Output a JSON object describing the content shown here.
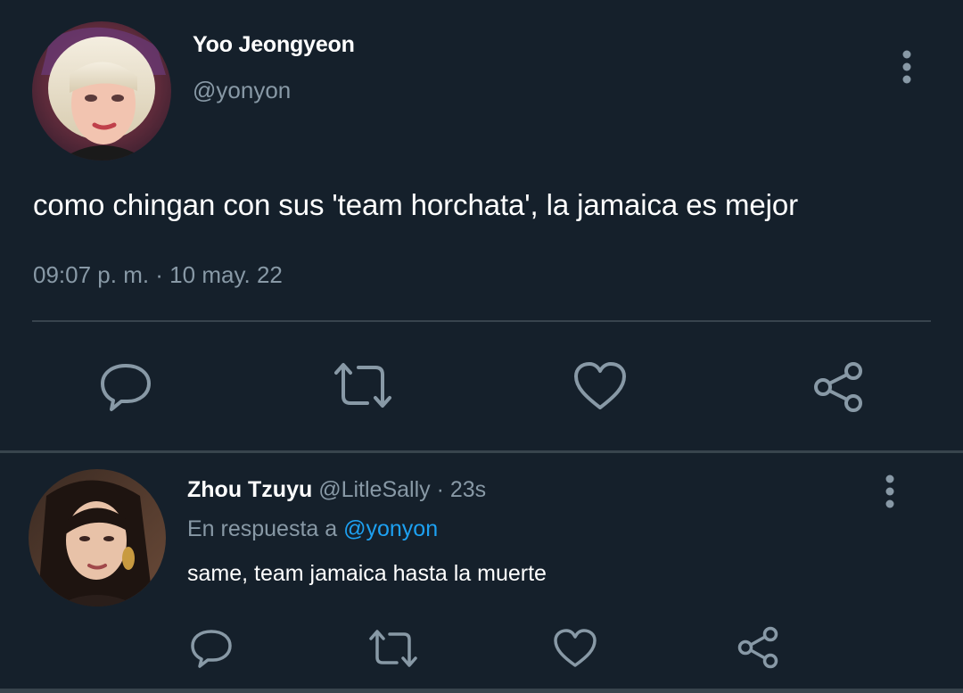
{
  "main_tweet": {
    "author_name": "Yoo Jeongyeon",
    "author_handle": "@yonyon",
    "text": "como chingan con sus 'team horchata', la jamaica es mejor",
    "timestamp": "09:07 p. m. · 10 may. 22",
    "more_icon": "more-vertical-icon",
    "actions": [
      "reply-icon",
      "retweet-icon",
      "like-icon",
      "share-icon"
    ]
  },
  "reply": {
    "author_name": "Zhou Tzuyu",
    "author_handle": "@LitleSally",
    "separator": "·",
    "time_ago": "23s",
    "replying_to_label": "En respuesta a",
    "replying_to_handle": "@yonyon",
    "text": "same, team jamaica hasta la muerte",
    "more_icon": "more-vertical-icon",
    "actions": [
      "reply-icon",
      "retweet-icon",
      "like-icon",
      "share-icon"
    ]
  },
  "colors": {
    "background": "#15202b",
    "primary_text": "#ffffff",
    "secondary_text": "#8899a6",
    "link": "#1da1f2",
    "divider": "#38444d"
  }
}
